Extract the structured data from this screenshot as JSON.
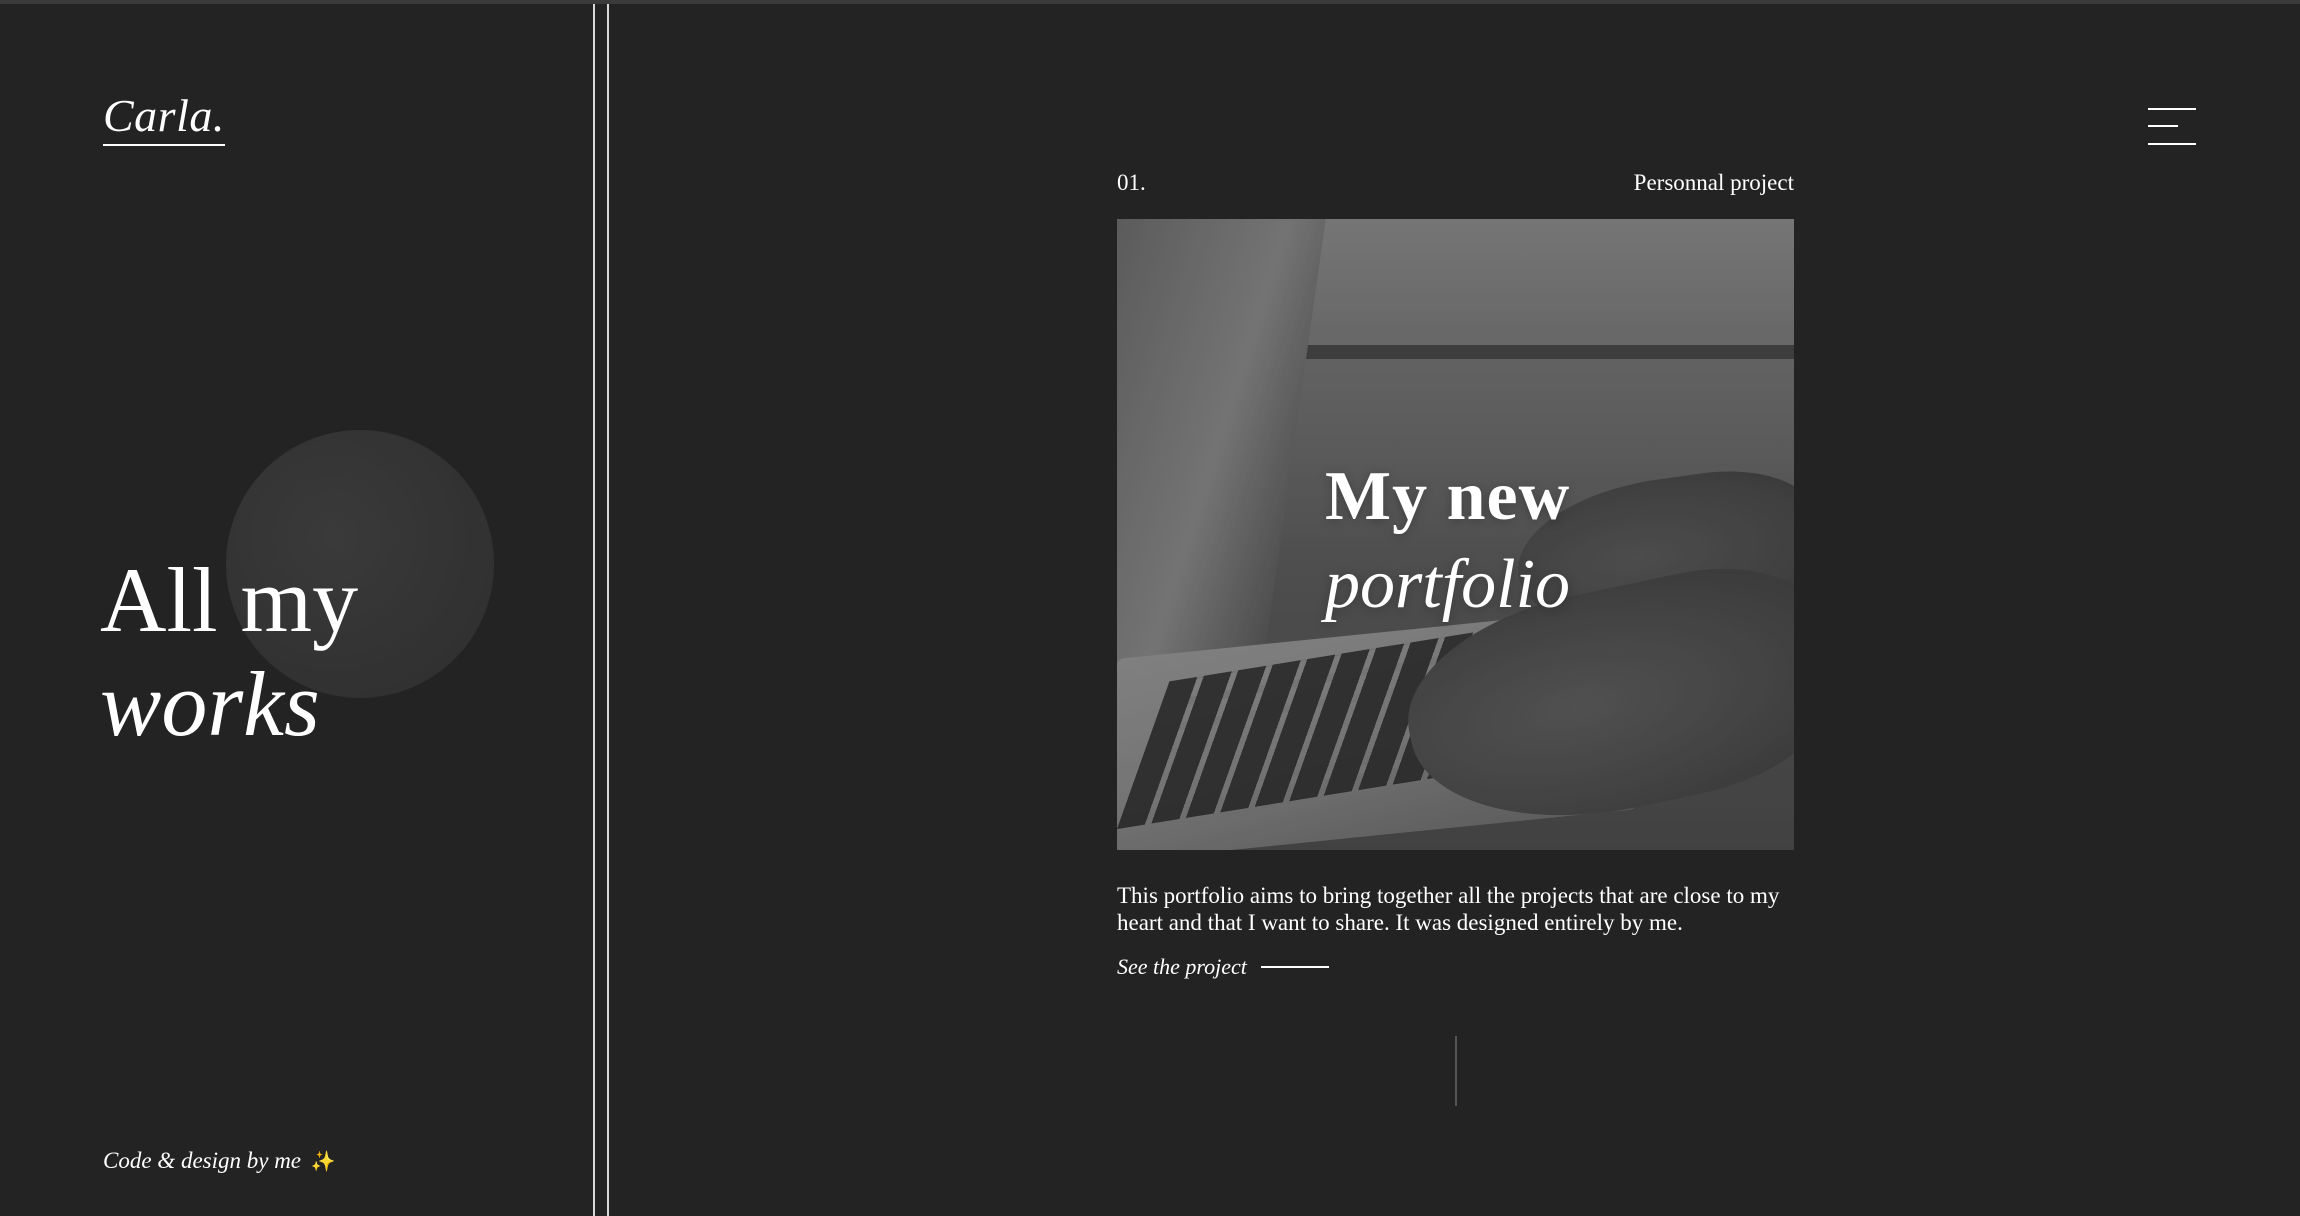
{
  "brand": {
    "logo": "Carla."
  },
  "hero": {
    "line1": "All my",
    "line2": "works"
  },
  "footer": {
    "credit": "Code & design by me",
    "emoji": "✨"
  },
  "menu": {
    "icon": "hamburger-menu-icon"
  },
  "project": {
    "number": "01.",
    "category": "Personnal project",
    "image_title_line1": "My new",
    "image_title_line2": "portfolio",
    "description": "This portfolio aims to bring together all the projects that are close to my heart and that I want to share. It was designed entirely by me.",
    "link_label": "See the project"
  },
  "colors": {
    "background": "#232323",
    "text": "#ffffff",
    "accent_sparkle": "#f3c847"
  }
}
